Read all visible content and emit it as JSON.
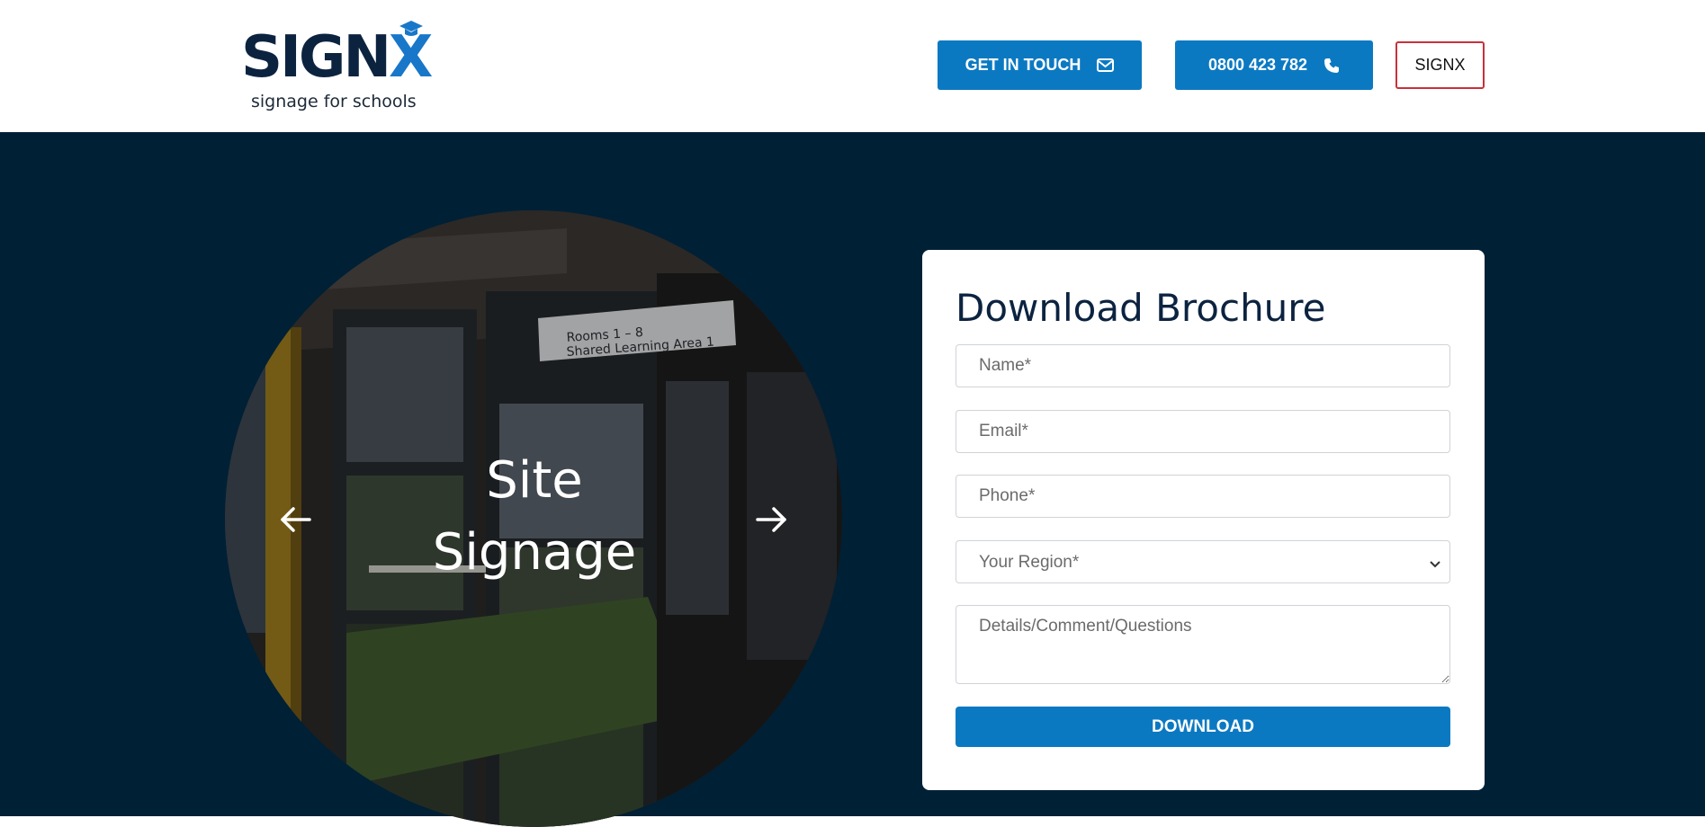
{
  "header": {
    "logo": {
      "wordmark_main": "SIGN",
      "wordmark_x": "X",
      "tagline": "signage for schools",
      "brand_dark": "#0c2340",
      "brand_blue": "#1877c9"
    },
    "contact_button": {
      "label": "GET IN TOUCH",
      "icon": "envelope-icon"
    },
    "phone_button": {
      "label": "0800 423 782",
      "icon": "phone-icon"
    },
    "signx_button": {
      "label": "SIGNX"
    }
  },
  "hero": {
    "background": "#002036",
    "slider": {
      "slide_title": "Site Signage",
      "slide_title_line1": "Site",
      "slide_title_line2": "Signage",
      "photo_sign_line1": "Rooms 1 – 8",
      "photo_sign_line2": "Shared Learning Area 1",
      "prev_icon": "arrow-left-icon",
      "next_icon": "arrow-right-icon"
    },
    "form": {
      "title": "Download Brochure",
      "name_placeholder": "Name*",
      "email_placeholder": "Email*",
      "phone_placeholder": "Phone*",
      "region_selected": "Your Region*",
      "details_placeholder": "Details/Comment/Questions",
      "submit_label": "DOWNLOAD",
      "accent": "#0b79c2"
    }
  }
}
